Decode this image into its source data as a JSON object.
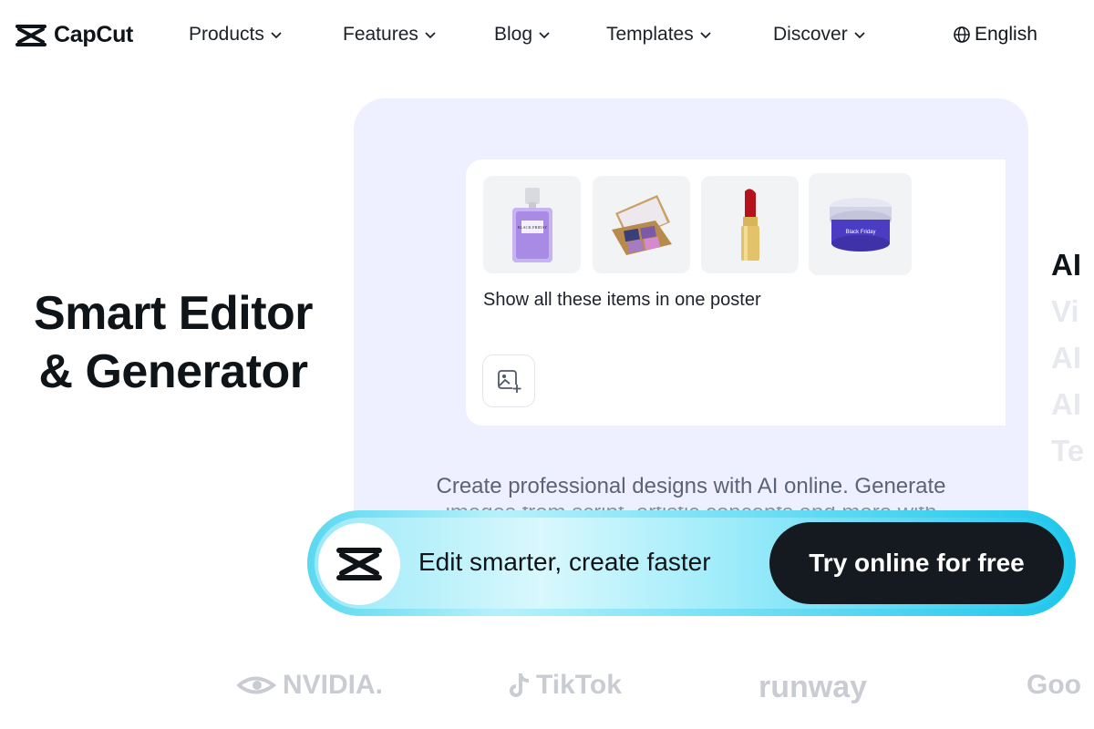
{
  "header": {
    "logo_text": "CapCut",
    "nav": [
      {
        "label": "Products"
      },
      {
        "label": "Features"
      },
      {
        "label": "Blog"
      },
      {
        "label": "Templates"
      },
      {
        "label": "Discover"
      }
    ],
    "language": "English"
  },
  "hero": {
    "headline_line1": "Smart Editor",
    "headline_line2": "& Generator"
  },
  "card": {
    "prompt_text": "Show all these items in one poster",
    "thumbnails": [
      "perfume-bottle",
      "eyeshadow-palette",
      "lipstick",
      "cream-jar"
    ],
    "perfume_label": "BLACK FRIDAY",
    "cream_label": "Black Friday",
    "description": "Create professional designs with AI online. Generate",
    "description_cont": "images from script, artistic concepts and more with"
  },
  "side_list": [
    "AI",
    "Vi",
    "AI",
    "AI",
    "Te"
  ],
  "cta": {
    "text": "Edit smarter, create faster",
    "button_label": "Try online for free"
  },
  "partners": [
    "NVIDIA.",
    "TikTok",
    "runway",
    "Goo"
  ],
  "colors": {
    "card_bg": "#eef0ff",
    "cta_cyan": "#1fc6ec",
    "cta_button": "#141a1f",
    "partner_gray": "#c9ccd2"
  }
}
